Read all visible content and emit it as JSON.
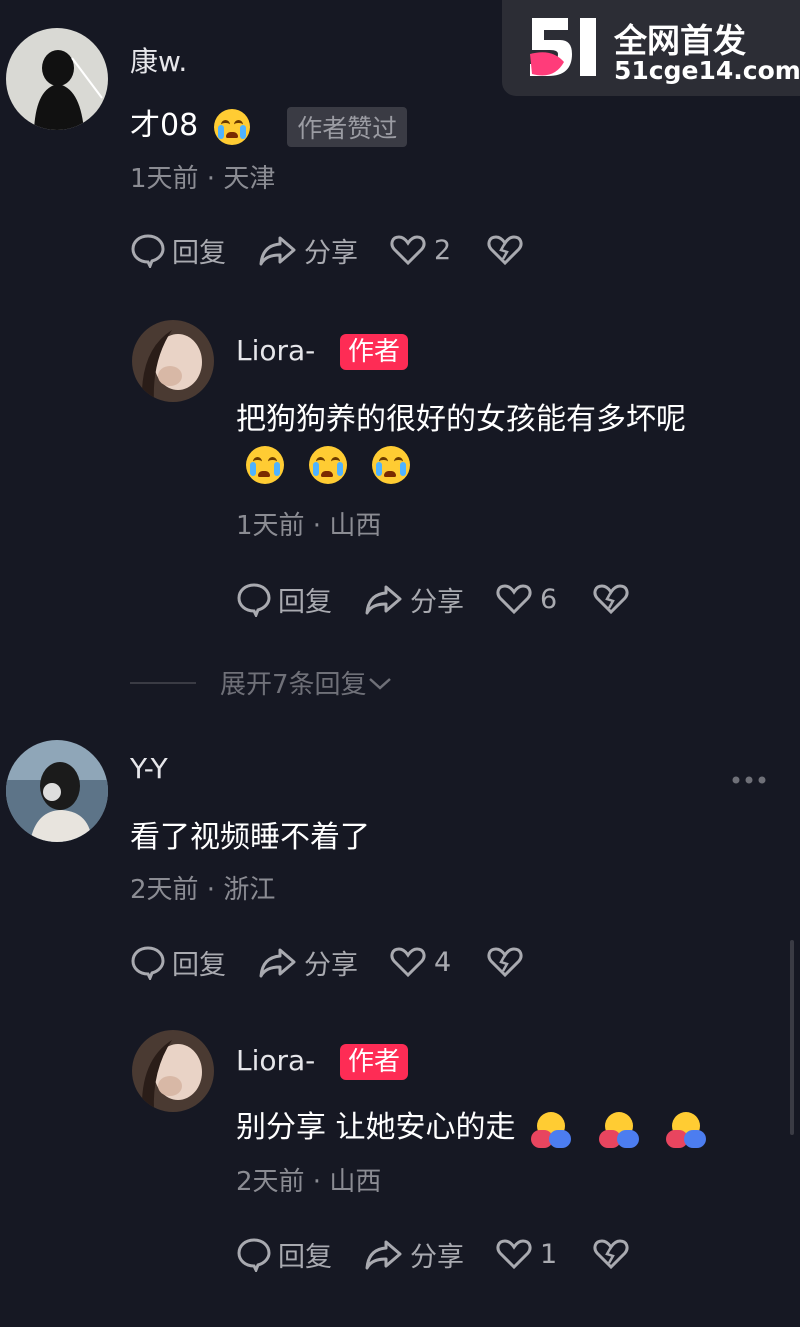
{
  "watermark": {
    "logo_text": "51",
    "title": "全网首发",
    "url": "51cge14.com"
  },
  "comments": [
    {
      "user": "康w.",
      "text": "才08",
      "liked_badge": "作者赞过",
      "meta": "1天前 · 天津",
      "reply_label": "回复",
      "share_label": "分享",
      "like_count": "2",
      "reply": {
        "user": "Liora-",
        "author_badge": "作者",
        "text": "把狗狗养的很好的女孩能有多坏呢",
        "meta": "1天前 · 山西",
        "reply_label": "回复",
        "share_label": "分享",
        "like_count": "6"
      }
    },
    {
      "expand_label": "展开7条回复"
    },
    {
      "user": "Y-Y",
      "text": "看了视频睡不着了",
      "meta": "2天前 · 浙江",
      "reply_label": "回复",
      "share_label": "分享",
      "like_count": "4",
      "reply": {
        "user": "Liora-",
        "author_badge": "作者",
        "text": "别分享 让她安心的走",
        "meta": "2天前 · 山西",
        "reply_label": "回复",
        "share_label": "分享",
        "like_count": "1"
      }
    }
  ],
  "colors": {
    "background": "#161823",
    "author_badge": "#fe2c55",
    "muted_text": "#8b8c93"
  },
  "icons": [
    "reply-icon",
    "share-icon",
    "heart-icon",
    "dislike-icon",
    "more-icon",
    "chevron-down-icon"
  ]
}
